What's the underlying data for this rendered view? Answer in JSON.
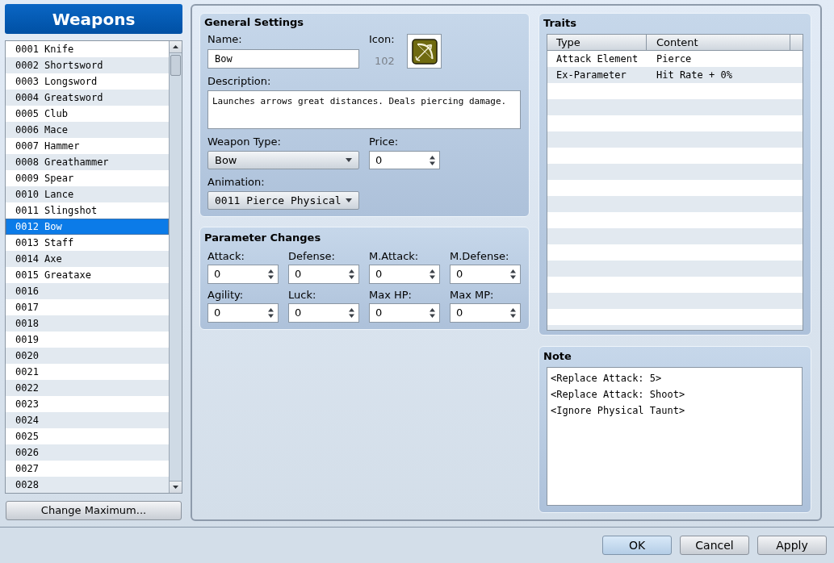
{
  "sidebar": {
    "title": "Weapons",
    "items": [
      {
        "label": "0001 Knife",
        "selected": false
      },
      {
        "label": "0002 Shortsword",
        "selected": false
      },
      {
        "label": "0003 Longsword",
        "selected": false
      },
      {
        "label": "0004 Greatsword",
        "selected": false
      },
      {
        "label": "0005 Club",
        "selected": false
      },
      {
        "label": "0006 Mace",
        "selected": false
      },
      {
        "label": "0007 Hammer",
        "selected": false
      },
      {
        "label": "0008 Greathammer",
        "selected": false
      },
      {
        "label": "0009 Spear",
        "selected": false
      },
      {
        "label": "0010 Lance",
        "selected": false
      },
      {
        "label": "0011 Slingshot",
        "selected": false
      },
      {
        "label": "0012 Bow",
        "selected": true
      },
      {
        "label": "0013 Staff",
        "selected": false
      },
      {
        "label": "0014 Axe",
        "selected": false
      },
      {
        "label": "0015 Greataxe",
        "selected": false
      },
      {
        "label": "0016",
        "selected": false
      },
      {
        "label": "0017",
        "selected": false
      },
      {
        "label": "0018",
        "selected": false
      },
      {
        "label": "0019",
        "selected": false
      },
      {
        "label": "0020",
        "selected": false
      },
      {
        "label": "0021",
        "selected": false
      },
      {
        "label": "0022",
        "selected": false
      },
      {
        "label": "0023",
        "selected": false
      },
      {
        "label": "0024",
        "selected": false
      },
      {
        "label": "0025",
        "selected": false
      },
      {
        "label": "0026",
        "selected": false
      },
      {
        "label": "0027",
        "selected": false
      },
      {
        "label": "0028",
        "selected": false
      }
    ],
    "button": "Change Maximum..."
  },
  "general_settings": {
    "title": "General Settings",
    "name": {
      "label": "Name:",
      "value": "Bow"
    },
    "icon": {
      "label": "Icon:",
      "index": "102"
    },
    "description": {
      "label": "Description:",
      "value": "Launches arrows great distances. Deals piercing damage."
    },
    "weapon_type": {
      "label": "Weapon Type:",
      "value": "Bow"
    },
    "price": {
      "label": "Price:",
      "value": "0"
    },
    "animation": {
      "label": "Animation:",
      "value": "0011 Pierce Physical"
    }
  },
  "parameter_changes": {
    "title": "Parameter Changes",
    "fields": [
      {
        "label": "Attack:",
        "value": "0"
      },
      {
        "label": "Defense:",
        "value": "0"
      },
      {
        "label": "M.Attack:",
        "value": "0"
      },
      {
        "label": "M.Defense:",
        "value": "0"
      },
      {
        "label": "Agility:",
        "value": "0"
      },
      {
        "label": "Luck:",
        "value": "0"
      },
      {
        "label": "Max HP:",
        "value": "0"
      },
      {
        "label": "Max MP:",
        "value": "0"
      }
    ]
  },
  "traits": {
    "title": "Traits",
    "columns": [
      "Type",
      "Content"
    ],
    "rows": [
      [
        "Attack Element",
        "Pierce"
      ],
      [
        "Ex-Parameter",
        "Hit Rate + 0%"
      ]
    ]
  },
  "note": {
    "title": "Note",
    "lines": [
      "<Replace Attack: 5>",
      "<Replace Attack: Shoot>",
      "<Ignore Physical Taunt>"
    ]
  },
  "buttons": [
    {
      "label": "OK",
      "default": true
    },
    {
      "label": "Cancel",
      "default": false
    },
    {
      "label": "Apply",
      "default": false
    }
  ]
}
